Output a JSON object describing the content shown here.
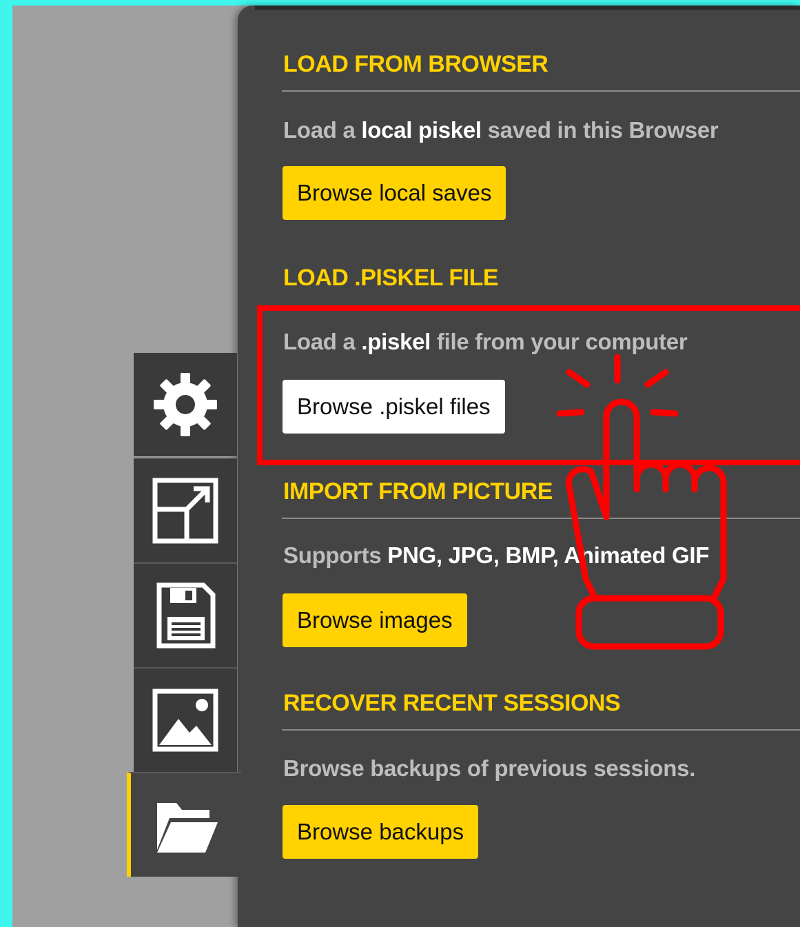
{
  "sections": [
    {
      "title": "LOAD FROM BROWSER",
      "desc": [
        [
          "Load a ",
          false
        ],
        [
          "local piskel",
          true
        ],
        [
          " saved in this Browser",
          false
        ]
      ],
      "button": "Browse local saves"
    },
    {
      "title": "LOAD .PISKEL FILE",
      "desc": [
        [
          "Load a ",
          false
        ],
        [
          ".piskel",
          true
        ],
        [
          " file from your computer",
          false
        ]
      ],
      "button": "Browse .piskel files"
    },
    {
      "title": "IMPORT FROM PICTURE",
      "desc": [
        [
          "Supports ",
          false
        ],
        [
          "PNG, JPG, BMP, Animated GIF",
          true
        ]
      ],
      "button": "Browse images"
    },
    {
      "title": "RECOVER RECENT SESSIONS",
      "desc": [
        [
          "Browse backups of previous sessions.",
          false
        ]
      ],
      "button": "Browse backups"
    }
  ],
  "tabs": [
    {
      "icon": "gear-icon"
    },
    {
      "icon": "resize-icon"
    },
    {
      "icon": "save-icon"
    },
    {
      "icon": "image-icon"
    },
    {
      "icon": "folder-open-icon",
      "active": true
    }
  ],
  "colors": {
    "accent": "#ffd200",
    "panel": "#444444",
    "highlight": "#ff0000",
    "background": "#3ff6ef"
  }
}
